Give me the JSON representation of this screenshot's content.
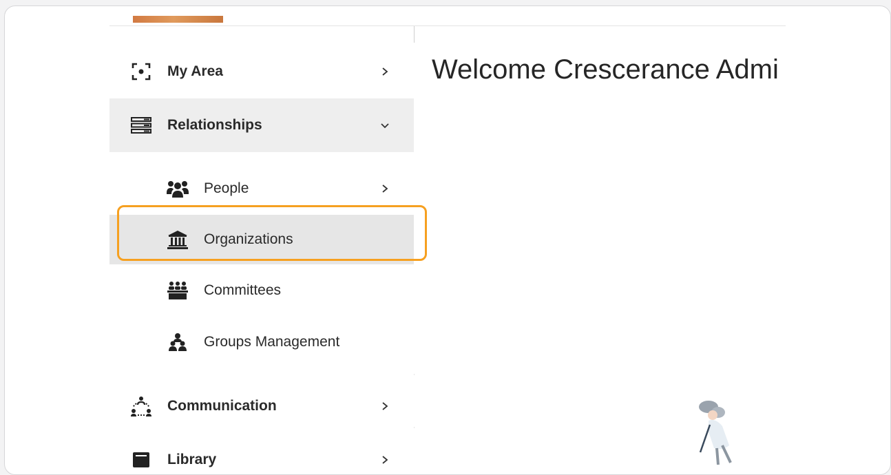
{
  "main": {
    "welcome_text": "Welcome Crescerance Admi"
  },
  "sidebar": {
    "items": [
      {
        "label": "My Area",
        "icon": "focus-icon",
        "chevron": "›"
      },
      {
        "label": "Relationships",
        "icon": "server-stack-icon",
        "chevron": "⌄"
      },
      {
        "label": "Communication",
        "icon": "network-people-icon",
        "chevron": "›"
      },
      {
        "label": "Library",
        "icon": "book-icon",
        "chevron": "›"
      }
    ],
    "sub_items": [
      {
        "label": "People",
        "icon": "users-icon",
        "chevron": "›"
      },
      {
        "label": "Organizations",
        "icon": "bank-icon"
      },
      {
        "label": "Committees",
        "icon": "committee-icon"
      },
      {
        "label": "Groups Management",
        "icon": "group-icon"
      }
    ]
  },
  "colors": {
    "highlight": "#f6a020",
    "active_bg": "#eeeeee",
    "selected_bg": "#e6e6e6"
  }
}
